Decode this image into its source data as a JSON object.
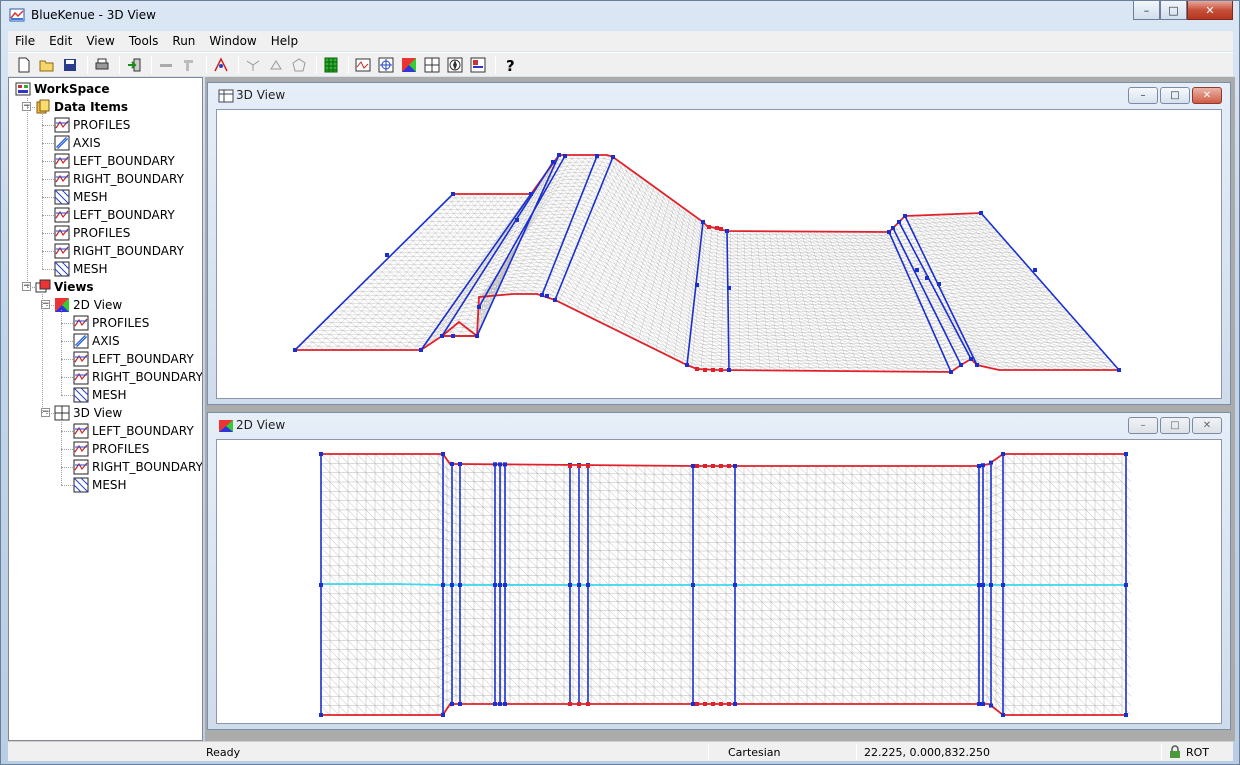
{
  "window": {
    "title": "BlueKenue - 3D View",
    "min": "–",
    "max": "□",
    "close": "✕"
  },
  "menu": [
    "File",
    "Edit",
    "View",
    "Tools",
    "Run",
    "Window",
    "Help"
  ],
  "toolbar_icons": [
    "new-icon",
    "open-icon",
    "save-icon",
    "print-icon",
    "import-icon",
    "line-icon",
    "edit-icon",
    "properties-icon",
    "node-icon",
    "point-icon",
    "polygon-icon",
    "grid-icon",
    "profile-icon",
    "target-icon",
    "colormap-icon",
    "cross-icon",
    "compass-icon",
    "table-icon",
    "help-icon"
  ],
  "tree": {
    "workspace": "WorkSpace",
    "data_items": "Data Items",
    "items": [
      "PROFILES",
      "AXIS",
      "LEFT_BOUNDARY",
      "RIGHT_BOUNDARY",
      "MESH",
      "LEFT_BOUNDARY",
      "PROFILES",
      "RIGHT_BOUNDARY",
      "MESH"
    ],
    "views": "Views",
    "view2d": {
      "label": "2D View",
      "items": [
        "PROFILES",
        "AXIS",
        "LEFT_BOUNDARY",
        "RIGHT_BOUNDARY",
        "MESH"
      ]
    },
    "view3d": {
      "label": "3D View",
      "items": [
        "LEFT_BOUNDARY",
        "PROFILES",
        "RIGHT_BOUNDARY",
        "MESH"
      ]
    }
  },
  "views": {
    "top_title": "3D View",
    "bottom_title": "2D View"
  },
  "status": {
    "ready": "Ready",
    "coord_system": "Cartesian",
    "coords": "22.225,  0.000,832.250",
    "mode": "ROT"
  },
  "colors": {
    "boundary": "#e0202a",
    "profile": "#1a2fd0",
    "axis": "#3fd8f0",
    "mesh": "#b4b4b4"
  }
}
